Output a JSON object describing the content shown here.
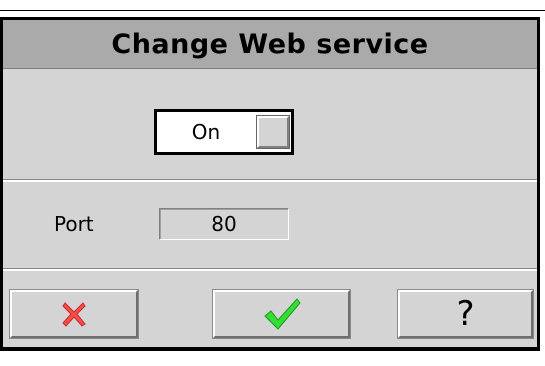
{
  "dialog": {
    "title": "Change Web service"
  },
  "service_toggle": {
    "state_label": "On"
  },
  "port": {
    "label": "Port",
    "value": "80"
  },
  "buttons": {
    "cancel_icon": "red-x-icon",
    "ok_icon": "green-check-icon",
    "help_label": "?"
  },
  "colors": {
    "cancel": "#ff4a4a",
    "ok": "#22cc22",
    "title_bar": "#aaaaaa",
    "panel": "#d4d4d4"
  }
}
